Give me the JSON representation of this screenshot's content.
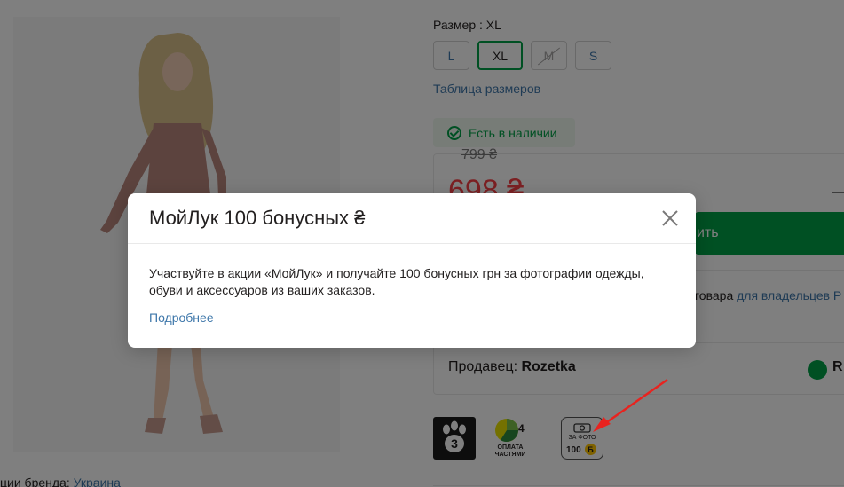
{
  "size": {
    "label": "Размер :",
    "selected": "XL",
    "options": [
      "L",
      "XL",
      "M",
      "S"
    ],
    "table_link": "Таблица размеров"
  },
  "stock": {
    "label": "Есть в наличии"
  },
  "price": {
    "old": "799 ₴",
    "new": "698 ₴",
    "buy_label": "ить"
  },
  "promo": {
    "text_visible": "говара",
    "link_visible": "для владельцев Р"
  },
  "seller": {
    "prefix": "Продавец:",
    "name": "Rozetka",
    "logo_letter": "R"
  },
  "services": {
    "paw_number": "3",
    "parts_number": "4",
    "parts_label_1": "ОПЛАТА",
    "parts_label_2": "ЧАСТЯМИ",
    "photo_label": "ЗА ФОТО",
    "photo_amount": "100",
    "photo_currency": "Б"
  },
  "brand": {
    "prefix": "ции бренда:",
    "country": "Украина"
  },
  "modal": {
    "title": "МойЛук 100 бонусных ₴",
    "text": "Участвуйте в акции «МойЛук» и получайте 100 бонусных грн за фотографии одежды, обуви и аксессуаров из ваших заказов.",
    "link": "Подробнее"
  },
  "colors": {
    "accent_green": "#00a046",
    "price_red": "#f84147",
    "link_blue": "#3e77aa",
    "overlay": "rgba(0,0,0,0.5)",
    "annotation_red": "#e8231f"
  }
}
